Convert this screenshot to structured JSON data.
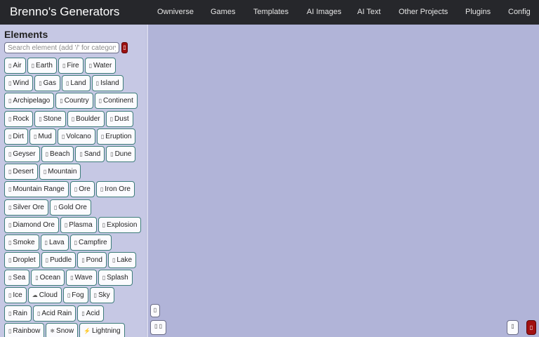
{
  "app": {
    "title": "Brenno's Generators"
  },
  "nav": {
    "omniverse": "Owniverse",
    "games": "Games",
    "templates": "Templates",
    "ai_images": "AI Images",
    "ai_text": "AI Text",
    "other_projects": "Other Projects",
    "plugins": "Plugins",
    "config": "Config"
  },
  "sidebar": {
    "title": "Elements",
    "search_placeholder": "Search element (add '/' for category)",
    "rows": [
      [
        {
          "icon": "▯",
          "label": "Air"
        },
        {
          "icon": "▯",
          "label": "Earth"
        },
        {
          "icon": "▯",
          "label": "Fire"
        },
        {
          "icon": "▯",
          "label": "Water"
        }
      ],
      [
        {
          "icon": "▯",
          "label": "Wind"
        },
        {
          "icon": "▯",
          "label": "Gas"
        },
        {
          "icon": "▯",
          "label": "Land"
        },
        {
          "icon": "▯",
          "label": "Island"
        }
      ],
      [
        {
          "icon": "▯",
          "label": "Archipelago"
        },
        {
          "icon": "▯",
          "label": "Country"
        },
        {
          "icon": "▯",
          "label": "Continent"
        }
      ],
      [
        {
          "icon": "▯",
          "label": "Rock"
        },
        {
          "icon": "▯",
          "label": "Stone"
        },
        {
          "icon": "▯",
          "label": "Boulder"
        },
        {
          "icon": "▯",
          "label": "Dust"
        }
      ],
      [
        {
          "icon": "▯",
          "label": "Dirt"
        },
        {
          "icon": "▯",
          "label": "Mud"
        },
        {
          "icon": "▯",
          "label": "Volcano"
        },
        {
          "icon": "▯",
          "label": "Eruption"
        }
      ],
      [
        {
          "icon": "▯",
          "label": "Geyser"
        },
        {
          "icon": "▯",
          "label": "Beach"
        },
        {
          "icon": "▯",
          "label": "Sand"
        },
        {
          "icon": "▯",
          "label": "Dune"
        }
      ],
      [
        {
          "icon": "▯",
          "label": "Desert"
        },
        {
          "icon": "▯",
          "label": "Mountain"
        }
      ],
      [
        {
          "icon": "▯",
          "label": "Mountain Range"
        },
        {
          "icon": "▯",
          "label": "Ore"
        },
        {
          "icon": "▯",
          "label": "Iron Ore"
        }
      ],
      [
        {
          "icon": "▯",
          "label": "Silver Ore"
        },
        {
          "icon": "▯",
          "label": "Gold Ore"
        }
      ],
      [
        {
          "icon": "▯",
          "label": "Diamond Ore"
        },
        {
          "icon": "▯",
          "label": "Plasma"
        },
        {
          "icon": "▯",
          "label": "Explosion"
        }
      ],
      [
        {
          "icon": "▯",
          "label": "Smoke"
        },
        {
          "icon": "▯",
          "label": "Lava"
        },
        {
          "icon": "▯",
          "label": "Campfire"
        }
      ],
      [
        {
          "icon": "▯",
          "label": "Droplet"
        },
        {
          "icon": "▯",
          "label": "Puddle"
        },
        {
          "icon": "▯",
          "label": "Pond"
        },
        {
          "icon": "▯",
          "label": "Lake"
        }
      ],
      [
        {
          "icon": "▯",
          "label": "Sea"
        },
        {
          "icon": "▯",
          "label": "Ocean"
        },
        {
          "icon": "▯",
          "label": "Wave"
        },
        {
          "icon": "▯",
          "label": "Splash"
        }
      ],
      [
        {
          "icon": "▯",
          "label": "Ice"
        },
        {
          "icon": "☁",
          "label": "Cloud"
        },
        {
          "icon": "▯",
          "label": "Fog"
        },
        {
          "icon": "▯",
          "label": "Sky"
        }
      ],
      [
        {
          "icon": "▯",
          "label": "Rain"
        },
        {
          "icon": "▯",
          "label": "Acid Rain"
        },
        {
          "icon": "▯",
          "label": "Acid"
        }
      ],
      [
        {
          "icon": "▯",
          "label": "Rainbow"
        },
        {
          "icon": "❄",
          "label": "Snow"
        },
        {
          "icon": "⚡",
          "label": "Lightning"
        }
      ]
    ]
  },
  "canvas": {
    "zoom_icon": "▯",
    "view_icon": "▯ ▯",
    "corner_icon": "▯",
    "trash_icon": "▯"
  },
  "colors": {
    "topbar": "#26272b",
    "canvas": "#b1b4d8",
    "sidebar": "#c6c8e4",
    "chip_border": "#3e7d7b",
    "danger": "#a21111"
  }
}
